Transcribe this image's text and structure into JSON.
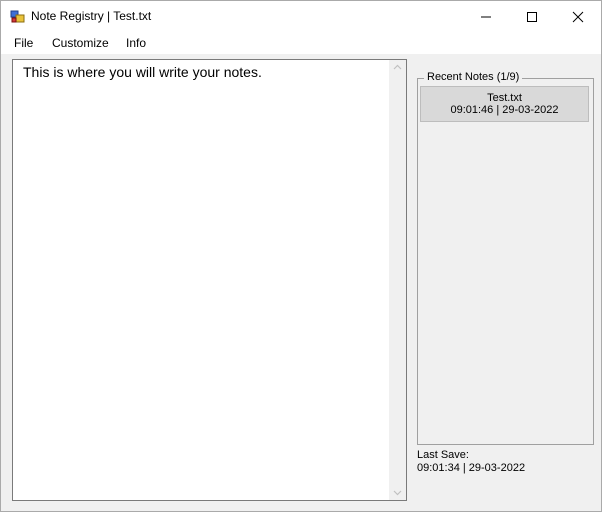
{
  "window": {
    "title": "Note Registry | Test.txt"
  },
  "menu": {
    "items": [
      "File",
      "Customize",
      "Info"
    ]
  },
  "editor": {
    "text": "This is where you will write your notes."
  },
  "recent": {
    "title": "Recent Notes (1/9)",
    "items": [
      {
        "name": "Test.txt",
        "timestamp": "09:01:46 | 29-03-2022"
      }
    ]
  },
  "status": {
    "last_save_label": "Last Save:",
    "last_save_value": "09:01:34 | 29-03-2022"
  }
}
